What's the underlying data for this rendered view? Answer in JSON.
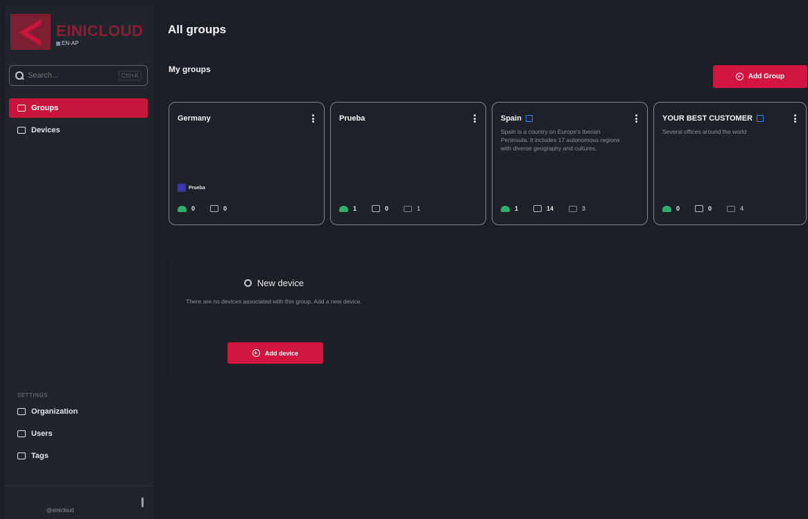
{
  "brand": {
    "name": "EINICLOUD",
    "sub": "EN-AP"
  },
  "search": {
    "placeholder": "Search...",
    "shortcut": "Ctrl+K"
  },
  "sidebar": {
    "items": [
      {
        "label": "Groups",
        "icon": "folder-icon",
        "active": true
      },
      {
        "label": "Devices",
        "icon": "device-icon",
        "active": false
      }
    ],
    "settings_title": "SETTINGS",
    "settings_items": [
      {
        "label": "Organization",
        "icon": "building-icon"
      },
      {
        "label": "Users",
        "icon": "users-icon"
      },
      {
        "label": "Tags",
        "icon": "tag-icon"
      }
    ],
    "footer_user": "@einicloud"
  },
  "page": {
    "title": "All groups",
    "section": "My groups",
    "add_group_label": "Add Group"
  },
  "groups": [
    {
      "name": "Germany",
      "flag": false,
      "description": "",
      "tag": "Prueba",
      "online": "0",
      "devices": "0",
      "subgroups": ""
    },
    {
      "name": "Prueba",
      "flag": false,
      "description": "",
      "tag": "",
      "online": "1",
      "devices": "0",
      "subgroups": "1"
    },
    {
      "name": "Spain",
      "flag": true,
      "description": "Spain is a country on Europe's Iberian Peninsula. It includes 17 autonomous regions with diverse geography and cultures.",
      "tag": "",
      "online": "1",
      "devices": "14",
      "subgroups": "3"
    },
    {
      "name": "YOUR BEST CUSTOMER",
      "flag": true,
      "description": "Several offices around the world",
      "tag": "",
      "online": "0",
      "devices": "0",
      "subgroups": "4"
    }
  ],
  "new_device": {
    "title": "New device",
    "description": "There are no devices associated with this group. Add a new device.",
    "button_label": "Add device"
  },
  "colors": {
    "accent": "#d11541",
    "background": "#1b1f25",
    "sidebar": "#20252c",
    "online": "#2fae6e"
  }
}
